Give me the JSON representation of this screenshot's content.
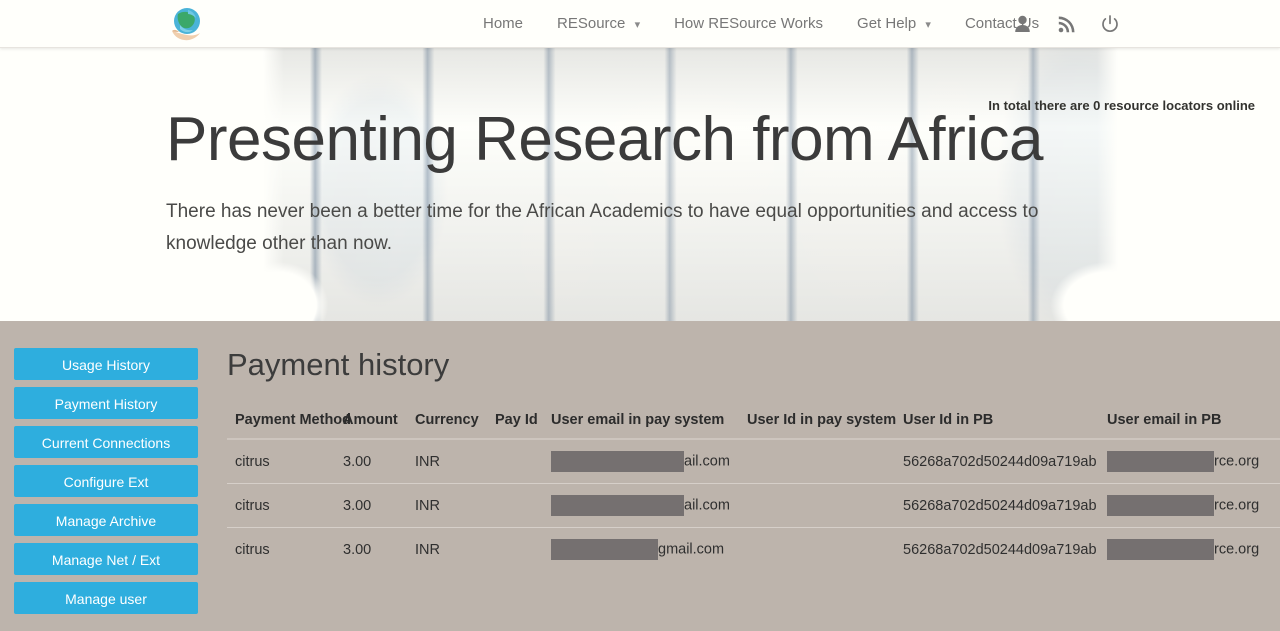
{
  "navbar": {
    "logo_name": "globe-in-hand-logo",
    "links": [
      {
        "label": "Home",
        "has_caret": false
      },
      {
        "label": "RESource",
        "has_caret": true
      },
      {
        "label": "How RESource Works",
        "has_caret": false
      },
      {
        "label": "Get Help",
        "has_caret": true
      },
      {
        "label": "Contact Us",
        "has_caret": false
      }
    ],
    "icons": [
      {
        "name": "user-icon"
      },
      {
        "name": "rss-icon"
      },
      {
        "name": "power-icon"
      }
    ]
  },
  "hero": {
    "status_text": "In total there are 0 resource locators online",
    "title": "Presenting Research from Africa",
    "subtitle": "There has never been a better time for the African Academics to have equal opportunities and access to knowledge other than now.",
    "image_alt": "blue-painted-hands-world-map"
  },
  "sidebar": {
    "items": [
      {
        "label": "Usage History"
      },
      {
        "label": "Payment History"
      },
      {
        "label": "Current Connections"
      },
      {
        "label": "Configure Ext"
      },
      {
        "label": "Manage Archive"
      },
      {
        "label": "Manage Net / Ext"
      },
      {
        "label": "Manage user"
      }
    ]
  },
  "main": {
    "page_title": "Payment history",
    "table": {
      "headers": [
        "Payment Method",
        "Amount",
        "Currency",
        "Pay Id",
        "User email in pay system",
        "User Id in pay system",
        "User Id in PB",
        "User email in PB"
      ],
      "rows": [
        {
          "payment_method": "citrus",
          "amount": "3.00",
          "currency": "INR",
          "pay_id": "",
          "user_email_pay_visible": "ail.com",
          "user_id_pay": "",
          "user_id_pb": "56268a702d50244d09a719ab",
          "user_email_pb_visible": "rce.org"
        },
        {
          "payment_method": "citrus",
          "amount": "3.00",
          "currency": "INR",
          "pay_id": "",
          "user_email_pay_visible": "ail.com",
          "user_id_pay": "",
          "user_id_pb": "56268a702d50244d09a719ab",
          "user_email_pb_visible": "rce.org"
        },
        {
          "payment_method": "citrus",
          "amount": "3.00",
          "currency": "INR",
          "pay_id": "",
          "user_email_pay_visible": "gmail.com",
          "user_id_pay": "",
          "user_id_pb": "56268a702d50244d09a719ab",
          "user_email_pb_visible": "rce.org"
        }
      ]
    }
  },
  "colors": {
    "accent_button": "#2eaede",
    "content_background": "#bdb4ac",
    "navbar_background": "#fffffb",
    "redaction": "#757070"
  }
}
